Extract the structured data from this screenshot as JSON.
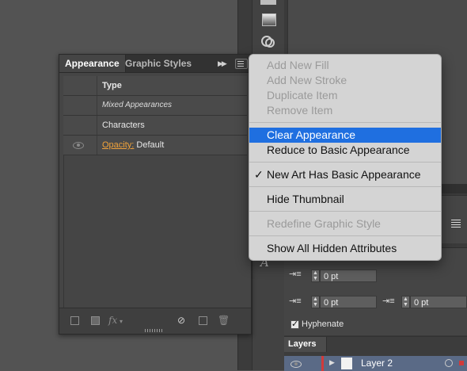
{
  "appearance_panel": {
    "tabs": [
      "Appearance",
      "Graphic Styles"
    ],
    "rows": [
      {
        "label": "Type",
        "style": "bold"
      },
      {
        "label": "Mixed Appearances",
        "style": "italic"
      },
      {
        "label": "Characters",
        "style": "normal"
      },
      {
        "link": "Opacity:",
        "value": "Default",
        "style": "opacity"
      }
    ],
    "footer_fx": "fx"
  },
  "flyout_menu": {
    "group1": [
      "Add New Fill",
      "Add New Stroke",
      "Duplicate Item",
      "Remove Item"
    ],
    "group2": [
      "Clear Appearance",
      "Reduce to Basic Appearance"
    ],
    "highlighted": "Clear Appearance",
    "checked_item": "New Art Has Basic Appearance",
    "check_mark": "✓",
    "thumbnail_item": "Hide Thumbnail",
    "redefine_item": "Redefine Graphic Style",
    "hidden_attrs_item": "Show All Hidden Attributes"
  },
  "paragraph_panel": {
    "indent_1": "0 pt",
    "indent_2": "0 pt",
    "indent_3": "0 pt",
    "hyphenate_label": "Hyphenate",
    "hyphenate_checked": true
  },
  "layers_panel": {
    "title": "Layers",
    "layer_name": "Layer 2"
  },
  "colors": {
    "highlight": "#1f6fe0",
    "opacity_link": "#f0a23a",
    "layer_color": "#d23a3a"
  }
}
